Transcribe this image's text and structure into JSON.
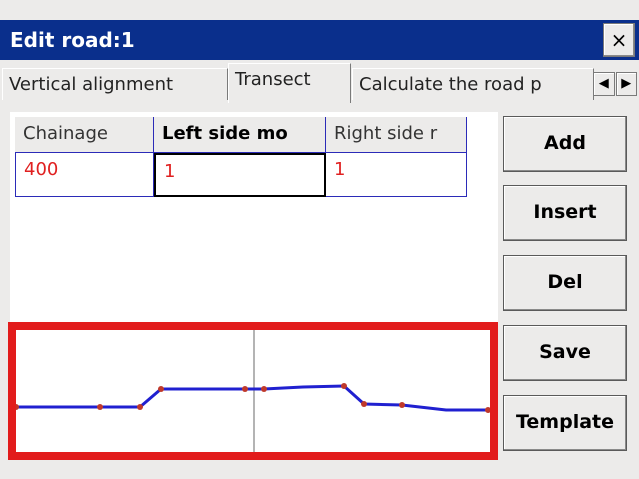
{
  "window": {
    "title": "Edit road:1",
    "close_label": "×"
  },
  "tabs": [
    {
      "label": "Vertical alignment",
      "active": false
    },
    {
      "label": "Transect",
      "active": true
    },
    {
      "label": "Calculate the road p",
      "active": false
    }
  ],
  "tab_scroll": {
    "left": "◀",
    "right": "▶"
  },
  "grid": {
    "columns": [
      "Chainage",
      "Left side mo",
      "Right side r"
    ],
    "rows": [
      [
        "400",
        "1",
        "1"
      ]
    ]
  },
  "buttons": {
    "add": "Add",
    "insert": "Insert",
    "del": "Del",
    "save": "Save",
    "template": "Template"
  },
  "colors": {
    "title_bar": "#0a2f8c",
    "highlight": "#e21c1c",
    "profile_line": "#2020d0",
    "vertex": "#c0392b",
    "value_text": "#e02020"
  },
  "icons": {
    "close": "close-icon",
    "scroll_left": "chevron-left-icon",
    "scroll_right": "chevron-right-icon"
  }
}
